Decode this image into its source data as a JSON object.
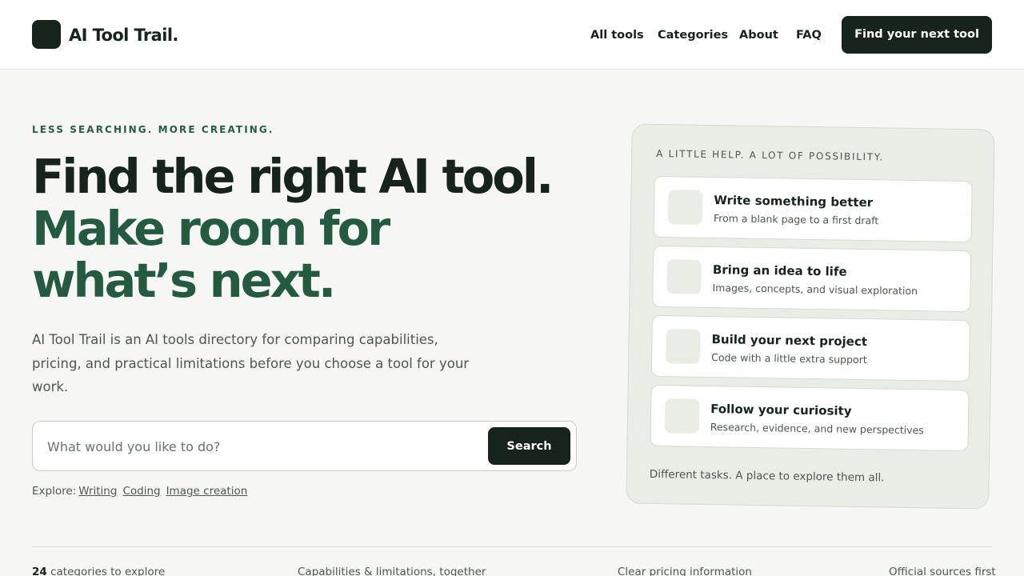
{
  "brand": {
    "name": "AI Tool Trail."
  },
  "nav": {
    "items": [
      {
        "label": "All tools"
      },
      {
        "label": "Categories"
      },
      {
        "label": "About"
      },
      {
        "label": "FAQ"
      }
    ],
    "cta_label": "Find your next tool"
  },
  "hero": {
    "kicker": "LESS SEARCHING. MORE CREATING.",
    "headline_line1": "Find the right AI tool.",
    "headline_line2": "Make room for",
    "headline_line3": "what’s next.",
    "description": "AI Tool Trail is an AI tools directory for comparing capabilities, pricing, and practical limitations before you choose a tool for your work.",
    "search": {
      "placeholder": "What would you like to do?",
      "value": "",
      "button_label": "Search"
    },
    "explore": {
      "label": "Explore:",
      "links": [
        {
          "label": "Writing"
        },
        {
          "label": "Coding"
        },
        {
          "label": "Image creation"
        }
      ]
    }
  },
  "help_card": {
    "kicker": "A LITTLE HELP. A LOT OF POSSIBILITY.",
    "tasks": [
      {
        "title": "Write something better",
        "subtitle": "From a blank page to a first draft"
      },
      {
        "title": "Bring an idea to life",
        "subtitle": "Images, concepts, and visual exploration"
      },
      {
        "title": "Build your next project",
        "subtitle": "Code with a little extra support"
      },
      {
        "title": "Follow your curiosity",
        "subtitle": "Research, evidence, and new perspectives"
      }
    ],
    "footer": "Different tasks. A place to explore them all."
  },
  "stats": {
    "categories_count": "24",
    "categories_label": " categories to explore",
    "item2": "Capabilities & limitations, together",
    "item3": "Clear pricing information",
    "item4": "Official sources first"
  },
  "colors": {
    "ink": "#17231d",
    "accent_green": "#245a40",
    "page_bg": "#f6f7f4",
    "card_bg": "#e9ede5"
  }
}
